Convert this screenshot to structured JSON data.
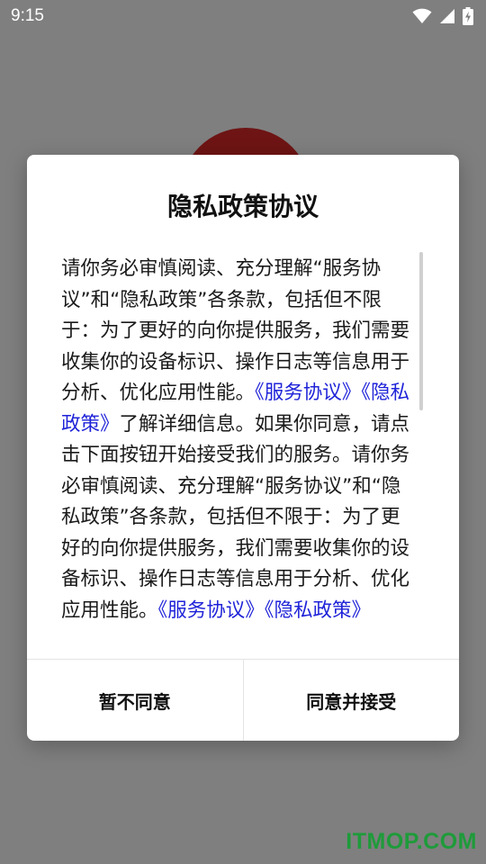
{
  "status_bar": {
    "time": "9:15",
    "icons": [
      "wifi-icon",
      "cell-signal-icon",
      "battery-charging-icon"
    ]
  },
  "background": {
    "logo": "app-logo"
  },
  "dialog": {
    "title": "隐私政策协议",
    "body": [
      {
        "text": "请你务必审慎阅读、充分理解“服务协议”和“隐私政策”各条款，包括但不限于：为了更好的向你提供服务，我们需要收集你的设备标识、操作日志等信息用于分析、优化应用性能。",
        "link": false
      },
      {
        "text": "《服务协议》",
        "link": true
      },
      {
        "text": "《隐私政策》",
        "link": true
      },
      {
        "text": "了解详细信息。如果你同意，请点击下面按钮开始接受我们的服务。请你务必审慎阅读、充分理解“服务协议”和“隐私政策”各条款，包括但不限于：为了更好的向你提供服务，我们需要收集你的设备标识、操作日志等信息用于分析、优化应用性能。",
        "link": false
      },
      {
        "text": "《服务协议》",
        "link": true
      },
      {
        "text": "《隐私政策》",
        "link": true
      }
    ],
    "decline_label": "暂不同意",
    "accept_label": "同意并接受"
  },
  "watermark": "ITMOP.COM",
  "colors": {
    "link": "#1f23d8",
    "scrim": "#7f7f7f",
    "watermark": "#1e9b3a"
  }
}
